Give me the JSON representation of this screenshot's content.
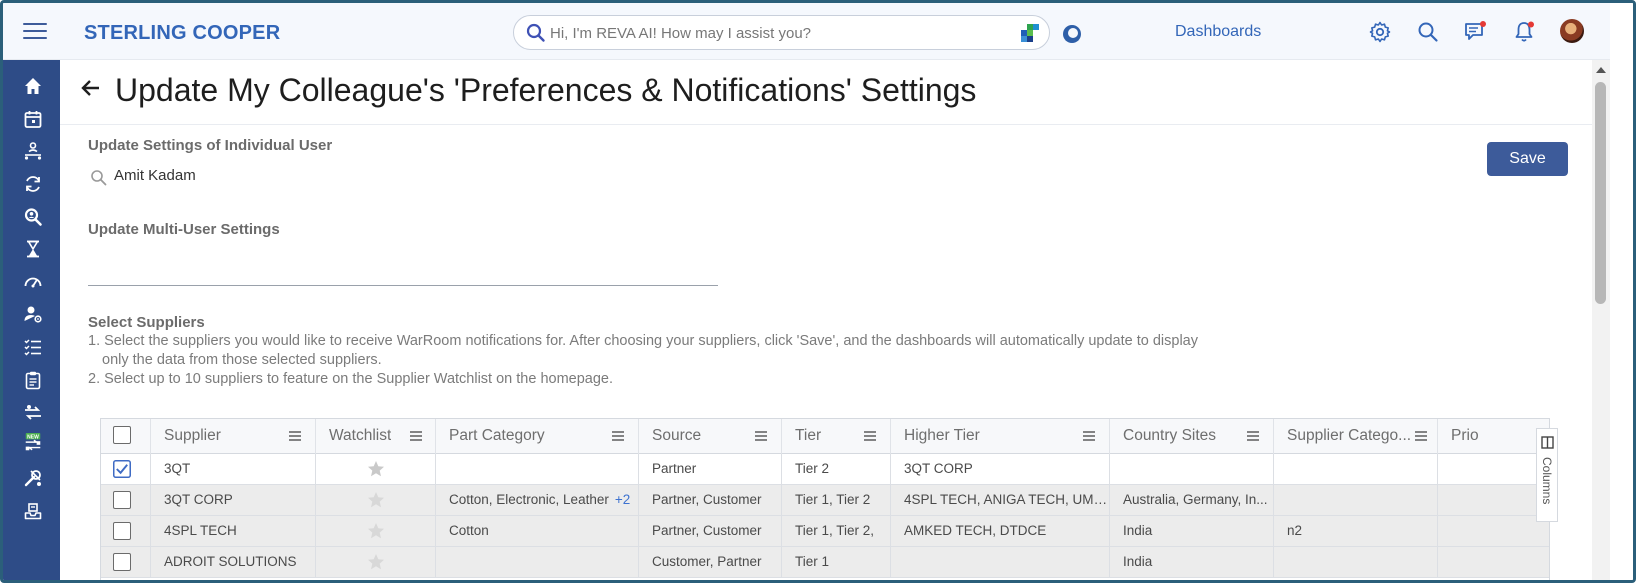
{
  "app": {
    "brand": "STERLING COOPER",
    "search_placeholder": "Hi, I'm REVA AI! How may I assist you?",
    "dashboards_link": "Dashboards"
  },
  "icons": {
    "top": [
      "settings-icon",
      "search-icon",
      "messages-icon",
      "notifications-icon"
    ],
    "sidebar": [
      "home-icon",
      "calendar-icon",
      "org-chart-icon",
      "refresh-cycle-icon",
      "search-person-icon",
      "hourglass-icon",
      "speedometer-icon",
      "user-settings-icon",
      "checklist-icon",
      "clipboard-icon",
      "transfer-icon",
      "new-feature-icon",
      "tools-icon",
      "inbox-tray-icon"
    ],
    "sidebar_badge": "NEW"
  },
  "colors": {
    "brand": "#3366b8",
    "sidebar": "#2e4c87",
    "primary_button": "#3d5b9a",
    "notification_dot": "#e53935"
  },
  "page": {
    "title": "Update My Colleague's 'Preferences & Notifications' Settings",
    "individual_label": "Update Settings of Individual User",
    "individual_user_value": "Amit Kadam",
    "save_label": "Save",
    "multi_label": "Update Multi-User Settings",
    "multi_value": "",
    "suppliers_label": "Select Suppliers",
    "instructions": [
      "1. Select the suppliers you would like to receive WarRoom notifications for. After choosing your suppliers, click 'Save', and the dashboards will automatically update to display",
      "only the data from those selected suppliers.",
      "2. Select up to 10 suppliers to feature on the Supplier Watchlist on the homepage."
    ]
  },
  "grid": {
    "columns": [
      "Supplier",
      "Watchlist",
      "Part Category",
      "Source",
      "Tier",
      "Higher Tier",
      "Country Sites",
      "Supplier Catego...",
      "Prio"
    ],
    "columns_panel_label": "Columns",
    "rows": [
      {
        "selected": true,
        "supplier": "3QT",
        "part_category": "",
        "more": "",
        "source": "Partner",
        "tier": "Tier 2",
        "higher_tier": "3QT CORP",
        "country_sites": "",
        "supplier_category": ""
      },
      {
        "selected": false,
        "supplier": "3QT CORP",
        "part_category": "Cotton, Electronic, Leather",
        "more": "+2",
        "source": "Partner, Customer",
        "tier": "Tier 1, Tier 2",
        "higher_tier": "4SPL TECH, ANIGA TECH, UMB...",
        "country_sites": "Australia, Germany, In...",
        "supplier_category": ""
      },
      {
        "selected": false,
        "supplier": "4SPL TECH",
        "part_category": "Cotton",
        "more": "",
        "source": "Partner, Customer",
        "tier": "Tier 1, Tier 2,",
        "higher_tier": "AMKED TECH, DTDCE",
        "country_sites": "India",
        "supplier_category": "n2"
      },
      {
        "selected": false,
        "supplier": "ADROIT SOLUTIONS",
        "part_category": "",
        "more": "",
        "source": "Customer, Partner",
        "tier": "Tier 1",
        "higher_tier": "",
        "country_sites": "India",
        "supplier_category": ""
      }
    ]
  }
}
